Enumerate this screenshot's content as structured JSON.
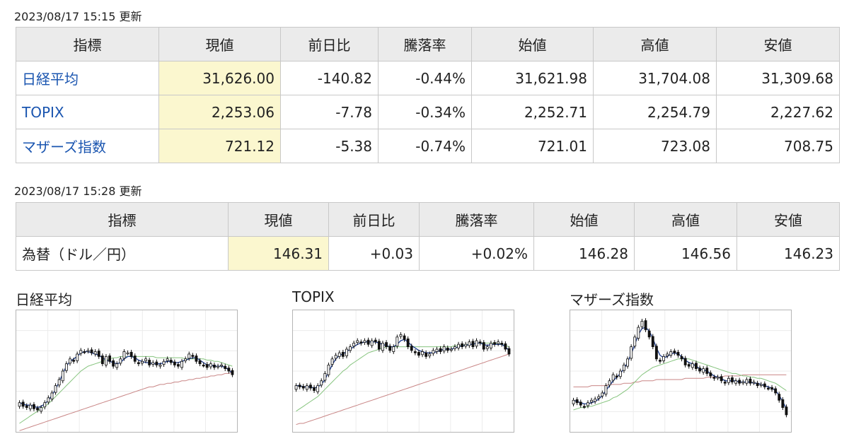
{
  "stock_table": {
    "updated": "2023/08/17 15:15 更新",
    "headers": [
      "指標",
      "現値",
      "前日比",
      "騰落率",
      "始値",
      "高値",
      "安値"
    ],
    "rows": [
      {
        "name": "日経平均",
        "current": "31,626.00",
        "change": "-140.82",
        "pct": "-0.44%",
        "open": "31,621.98",
        "high": "31,704.08",
        "low": "31,309.68"
      },
      {
        "name": "TOPIX",
        "current": "2,253.06",
        "change": "-7.78",
        "pct": "-0.34%",
        "open": "2,252.71",
        "high": "2,254.79",
        "low": "2,227.62"
      },
      {
        "name": "マザーズ指数",
        "current": "721.12",
        "change": "-5.38",
        "pct": "-0.74%",
        "open": "721.01",
        "high": "723.08",
        "low": "708.75"
      }
    ]
  },
  "fx_table": {
    "updated": "2023/08/17 15:28 更新",
    "headers": [
      "指標",
      "現値",
      "前日比",
      "騰落率",
      "始値",
      "高値",
      "安値"
    ],
    "row": {
      "name": "為替（ドル／円）",
      "current": "146.31",
      "change": "+0.03",
      "pct": "+0.02%",
      "open": "146.28",
      "high": "146.56",
      "low": "146.23"
    }
  },
  "colors": {
    "down": "#1f4fb3",
    "up": "#d1101e",
    "link": "#1a55b0",
    "current_bg": "#fbf7cf",
    "ma_short": "#1b3a8c",
    "ma_mid": "#86c47e",
    "ma_long": "#c98686"
  },
  "charts": [
    {
      "title": "日経平均"
    },
    {
      "title": "TOPIX"
    },
    {
      "title": "マザーズ指数"
    }
  ],
  "chart_data": [
    {
      "type": "candlestick",
      "title": "日経平均",
      "close": [
        0.76,
        0.79,
        0.8,
        0.78,
        0.81,
        0.82,
        0.8,
        0.76,
        0.72,
        0.68,
        0.62,
        0.57,
        0.5,
        0.44,
        0.4,
        0.42,
        0.36,
        0.33,
        0.34,
        0.33,
        0.35,
        0.34,
        0.38,
        0.44,
        0.38,
        0.42,
        0.46,
        0.44,
        0.4,
        0.34,
        0.35,
        0.38,
        0.42,
        0.44,
        0.42,
        0.4,
        0.45,
        0.43,
        0.45,
        0.45,
        0.42,
        0.4,
        0.43,
        0.45,
        0.46,
        0.42,
        0.4,
        0.36,
        0.38,
        0.42,
        0.44,
        0.45,
        0.47,
        0.44,
        0.47,
        0.46,
        0.45,
        0.48,
        0.5,
        0.53
      ],
      "ma_short": [
        0.76,
        0.77,
        0.78,
        0.78,
        0.79,
        0.8,
        0.79,
        0.77,
        0.74,
        0.7,
        0.65,
        0.59,
        0.52,
        0.46,
        0.42,
        0.4,
        0.38,
        0.35,
        0.34,
        0.34,
        0.35,
        0.36,
        0.37,
        0.39,
        0.41,
        0.42,
        0.43,
        0.44,
        0.43,
        0.4,
        0.38,
        0.38,
        0.39,
        0.41,
        0.42,
        0.43,
        0.43,
        0.44,
        0.44,
        0.44,
        0.43,
        0.42,
        0.42,
        0.43,
        0.43,
        0.42,
        0.41,
        0.4,
        0.39,
        0.39,
        0.41,
        0.43,
        0.45,
        0.45,
        0.46,
        0.46,
        0.46,
        0.47,
        0.49,
        0.52
      ],
      "ma_mid": [
        0.93,
        0.91,
        0.89,
        0.87,
        0.85,
        0.83,
        0.81,
        0.79,
        0.77,
        0.74,
        0.71,
        0.68,
        0.65,
        0.62,
        0.59,
        0.56,
        0.53,
        0.5,
        0.48,
        0.46,
        0.45,
        0.44,
        0.43,
        0.42,
        0.41,
        0.4,
        0.39,
        0.39,
        0.38,
        0.38,
        0.38,
        0.38,
        0.38,
        0.38,
        0.38,
        0.38,
        0.38,
        0.38,
        0.39,
        0.39,
        0.39,
        0.39,
        0.39,
        0.39,
        0.39,
        0.39,
        0.4,
        0.4,
        0.4,
        0.4,
        0.4,
        0.4,
        0.41,
        0.41,
        0.42,
        0.42,
        0.43,
        0.44,
        0.45,
        0.46
      ],
      "ma_long": [
        0.99,
        0.98,
        0.97,
        0.96,
        0.95,
        0.94,
        0.93,
        0.92,
        0.91,
        0.9,
        0.89,
        0.88,
        0.87,
        0.86,
        0.85,
        0.84,
        0.83,
        0.82,
        0.81,
        0.8,
        0.79,
        0.78,
        0.77,
        0.76,
        0.75,
        0.74,
        0.73,
        0.72,
        0.71,
        0.7,
        0.69,
        0.68,
        0.67,
        0.66,
        0.65,
        0.64,
        0.63,
        0.63,
        0.62,
        0.61,
        0.61,
        0.6,
        0.6,
        0.59,
        0.59,
        0.58,
        0.58,
        0.57,
        0.57,
        0.56,
        0.56,
        0.55,
        0.55,
        0.54,
        0.54,
        0.53,
        0.53,
        0.52,
        0.52,
        0.51
      ]
    },
    {
      "type": "candlestick",
      "title": "TOPIX",
      "close": [
        0.62,
        0.63,
        0.64,
        0.62,
        0.64,
        0.66,
        0.62,
        0.58,
        0.52,
        0.45,
        0.4,
        0.37,
        0.35,
        0.38,
        0.32,
        0.3,
        0.27,
        0.25,
        0.27,
        0.25,
        0.28,
        0.25,
        0.26,
        0.32,
        0.27,
        0.3,
        0.33,
        0.3,
        0.22,
        0.2,
        0.24,
        0.3,
        0.33,
        0.35,
        0.37,
        0.34,
        0.38,
        0.36,
        0.33,
        0.32,
        0.34,
        0.3,
        0.33,
        0.32,
        0.3,
        0.28,
        0.3,
        0.28,
        0.26,
        0.3,
        0.25,
        0.27,
        0.32,
        0.3,
        0.27,
        0.28,
        0.26,
        0.28,
        0.32,
        0.36
      ],
      "ma_short": [
        0.62,
        0.62,
        0.63,
        0.63,
        0.63,
        0.64,
        0.63,
        0.61,
        0.57,
        0.51,
        0.45,
        0.4,
        0.37,
        0.36,
        0.34,
        0.32,
        0.3,
        0.28,
        0.27,
        0.26,
        0.26,
        0.26,
        0.26,
        0.27,
        0.28,
        0.29,
        0.3,
        0.3,
        0.28,
        0.25,
        0.24,
        0.26,
        0.29,
        0.31,
        0.33,
        0.34,
        0.35,
        0.35,
        0.35,
        0.34,
        0.33,
        0.32,
        0.32,
        0.32,
        0.31,
        0.3,
        0.29,
        0.29,
        0.28,
        0.28,
        0.27,
        0.27,
        0.28,
        0.29,
        0.28,
        0.28,
        0.28,
        0.28,
        0.3,
        0.33
      ],
      "ma_mid": [
        0.83,
        0.81,
        0.79,
        0.77,
        0.75,
        0.73,
        0.71,
        0.68,
        0.65,
        0.62,
        0.59,
        0.56,
        0.53,
        0.5,
        0.48,
        0.45,
        0.43,
        0.41,
        0.39,
        0.37,
        0.35,
        0.34,
        0.33,
        0.32,
        0.31,
        0.3,
        0.3,
        0.3,
        0.3,
        0.3,
        0.3,
        0.3,
        0.3,
        0.3,
        0.3,
        0.3,
        0.3,
        0.3,
        0.3,
        0.3,
        0.3,
        0.3,
        0.3,
        0.3,
        0.29,
        0.29,
        0.29,
        0.28,
        0.28,
        0.28,
        0.27,
        0.27,
        0.27,
        0.27,
        0.27,
        0.27,
        0.27,
        0.28,
        0.29,
        0.3
      ],
      "ma_long": [
        0.94,
        0.93,
        0.93,
        0.92,
        0.91,
        0.9,
        0.89,
        0.88,
        0.87,
        0.86,
        0.85,
        0.84,
        0.83,
        0.82,
        0.81,
        0.8,
        0.79,
        0.78,
        0.77,
        0.76,
        0.75,
        0.74,
        0.73,
        0.72,
        0.71,
        0.7,
        0.69,
        0.68,
        0.67,
        0.66,
        0.65,
        0.64,
        0.63,
        0.62,
        0.61,
        0.6,
        0.59,
        0.58,
        0.57,
        0.56,
        0.55,
        0.54,
        0.53,
        0.52,
        0.51,
        0.5,
        0.49,
        0.48,
        0.47,
        0.46,
        0.45,
        0.44,
        0.43,
        0.42,
        0.41,
        0.4,
        0.39,
        0.38,
        0.37,
        0.36
      ]
    },
    {
      "type": "candlestick",
      "title": "マザーズ指数",
      "close": [
        0.74,
        0.76,
        0.78,
        0.79,
        0.76,
        0.74,
        0.73,
        0.71,
        0.68,
        0.62,
        0.58,
        0.53,
        0.55,
        0.5,
        0.45,
        0.4,
        0.3,
        0.22,
        0.14,
        0.09,
        0.16,
        0.22,
        0.3,
        0.4,
        0.42,
        0.38,
        0.36,
        0.34,
        0.35,
        0.37,
        0.4,
        0.45,
        0.46,
        0.44,
        0.48,
        0.5,
        0.48,
        0.52,
        0.54,
        0.56,
        0.55,
        0.58,
        0.6,
        0.56,
        0.59,
        0.58,
        0.6,
        0.59,
        0.57,
        0.6,
        0.59,
        0.62,
        0.61,
        0.63,
        0.64,
        0.65,
        0.68,
        0.74,
        0.8,
        0.86
      ],
      "ma_short": [
        0.74,
        0.75,
        0.76,
        0.77,
        0.77,
        0.76,
        0.75,
        0.73,
        0.7,
        0.66,
        0.62,
        0.58,
        0.55,
        0.52,
        0.48,
        0.43,
        0.36,
        0.28,
        0.2,
        0.15,
        0.14,
        0.17,
        0.23,
        0.31,
        0.37,
        0.39,
        0.38,
        0.36,
        0.35,
        0.36,
        0.38,
        0.41,
        0.43,
        0.44,
        0.46,
        0.48,
        0.49,
        0.5,
        0.52,
        0.54,
        0.55,
        0.56,
        0.58,
        0.58,
        0.58,
        0.58,
        0.59,
        0.59,
        0.59,
        0.59,
        0.6,
        0.6,
        0.61,
        0.62,
        0.63,
        0.64,
        0.66,
        0.7,
        0.75,
        0.81
      ],
      "ma_mid": [
        0.82,
        0.81,
        0.8,
        0.8,
        0.79,
        0.79,
        0.78,
        0.77,
        0.76,
        0.75,
        0.74,
        0.72,
        0.71,
        0.69,
        0.67,
        0.65,
        0.62,
        0.59,
        0.56,
        0.53,
        0.51,
        0.49,
        0.47,
        0.46,
        0.45,
        0.44,
        0.43,
        0.42,
        0.41,
        0.4,
        0.4,
        0.4,
        0.4,
        0.41,
        0.42,
        0.43,
        0.44,
        0.45,
        0.46,
        0.47,
        0.48,
        0.49,
        0.5,
        0.51,
        0.52,
        0.52,
        0.53,
        0.54,
        0.54,
        0.55,
        0.55,
        0.56,
        0.56,
        0.57,
        0.58,
        0.59,
        0.6,
        0.62,
        0.64,
        0.66
      ],
      "ma_long": [
        0.63,
        0.63,
        0.63,
        0.63,
        0.63,
        0.62,
        0.62,
        0.62,
        0.62,
        0.62,
        0.61,
        0.61,
        0.61,
        0.61,
        0.6,
        0.6,
        0.6,
        0.59,
        0.59,
        0.58,
        0.58,
        0.58,
        0.58,
        0.57,
        0.57,
        0.57,
        0.57,
        0.57,
        0.57,
        0.57,
        0.57,
        0.56,
        0.56,
        0.56,
        0.56,
        0.56,
        0.56,
        0.55,
        0.55,
        0.55,
        0.55,
        0.55,
        0.54,
        0.54,
        0.54,
        0.54,
        0.54,
        0.53,
        0.53,
        0.53,
        0.53,
        0.53,
        0.53,
        0.53,
        0.53,
        0.53,
        0.53,
        0.53,
        0.53,
        0.53
      ]
    }
  ]
}
